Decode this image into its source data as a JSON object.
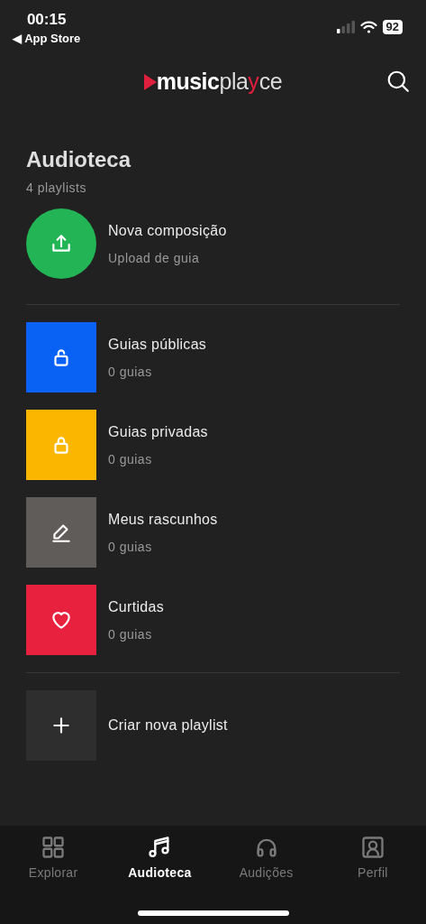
{
  "status_bar": {
    "time": "00:15",
    "back_link": "◀ App Store",
    "battery": "92"
  },
  "header": {
    "logo": {
      "bold": "music",
      "light": "pla",
      "accent": "y",
      "tail": "ce"
    }
  },
  "library": {
    "title": "Audioteca",
    "count": "4 playlists",
    "new_item": {
      "title": "Nova composição",
      "subtitle": "Upload de guia"
    },
    "playlists": [
      {
        "kind": "public",
        "title": "Guias públicas",
        "subtitle": "0 guias",
        "color": "#0a62f5"
      },
      {
        "kind": "private",
        "title": "Guias privadas",
        "subtitle": "0 guias",
        "color": "#fbb700"
      },
      {
        "kind": "drafts",
        "title": "Meus rascunhos",
        "subtitle": "0 guias",
        "color": "#605c5a"
      },
      {
        "kind": "liked",
        "title": "Curtidas",
        "subtitle": "0 guias",
        "color": "#e8213f"
      }
    ],
    "create": {
      "title": "Criar nova playlist"
    }
  },
  "tab_bar": [
    {
      "kind": "explore",
      "label": "Explorar",
      "selected": false
    },
    {
      "kind": "library",
      "label": "Audioteca",
      "selected": true
    },
    {
      "kind": "auditions",
      "label": "Audições",
      "selected": false
    },
    {
      "kind": "profile",
      "label": "Perfil",
      "selected": false
    }
  ]
}
